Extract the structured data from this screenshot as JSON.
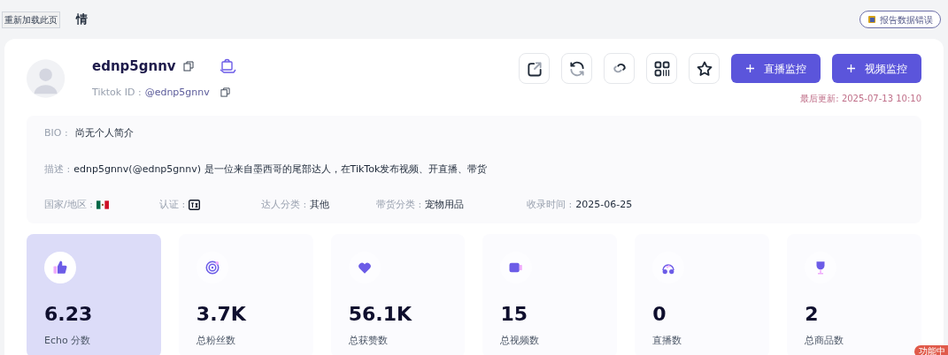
{
  "tooltip": "重新加载此页",
  "page_title": "情",
  "report_button": "报告数据错误",
  "profile": {
    "name": "ednp5gnnv",
    "id_label": "Tiktok ID :",
    "id_value": "@ednp5gnnv",
    "updated": "最后更新: 2025-07-13 10:10"
  },
  "actions": [
    {
      "kind": "share"
    },
    {
      "kind": "refresh"
    },
    {
      "kind": "link"
    },
    {
      "kind": "qr"
    },
    {
      "kind": "star"
    }
  ],
  "monitor_buttons": [
    "直播监控",
    "视频监控"
  ],
  "bio": {
    "label": "BIO :",
    "value": "尚无个人简介"
  },
  "description": {
    "label": "描述 :",
    "value": "ednp5gnnv(@ednp5gnnv) 是一位来自墨西哥的尾部达人，在TikTok发布视频、开直播、带货"
  },
  "attributes": [
    {
      "kind": "flag",
      "label": "国家/地区 :"
    },
    {
      "kind": "badge",
      "label": "认证 :"
    },
    {
      "kind": "text",
      "label": "达人分类 :",
      "value": "其他"
    },
    {
      "kind": "text",
      "label": "带货分类 :",
      "value": "宠物用品"
    },
    {
      "kind": "text",
      "label": "收录时间 :",
      "value": "2025-06-25"
    }
  ],
  "stats": [
    {
      "kind": "score",
      "value": "6.23",
      "label": "Echo 分数",
      "selected": true
    },
    {
      "kind": "fans",
      "value": "3.7K",
      "label": "总粉丝数",
      "selected": false
    },
    {
      "kind": "likes",
      "value": "56.1K",
      "label": "总获赞数",
      "selected": false
    },
    {
      "kind": "videos",
      "value": "15",
      "label": "总视频数",
      "selected": false
    },
    {
      "kind": "live",
      "value": "0",
      "label": "直播数",
      "selected": false
    },
    {
      "kind": "products",
      "value": "2",
      "label": "总商品数",
      "selected": false
    }
  ],
  "corner_badge": "功能中"
}
